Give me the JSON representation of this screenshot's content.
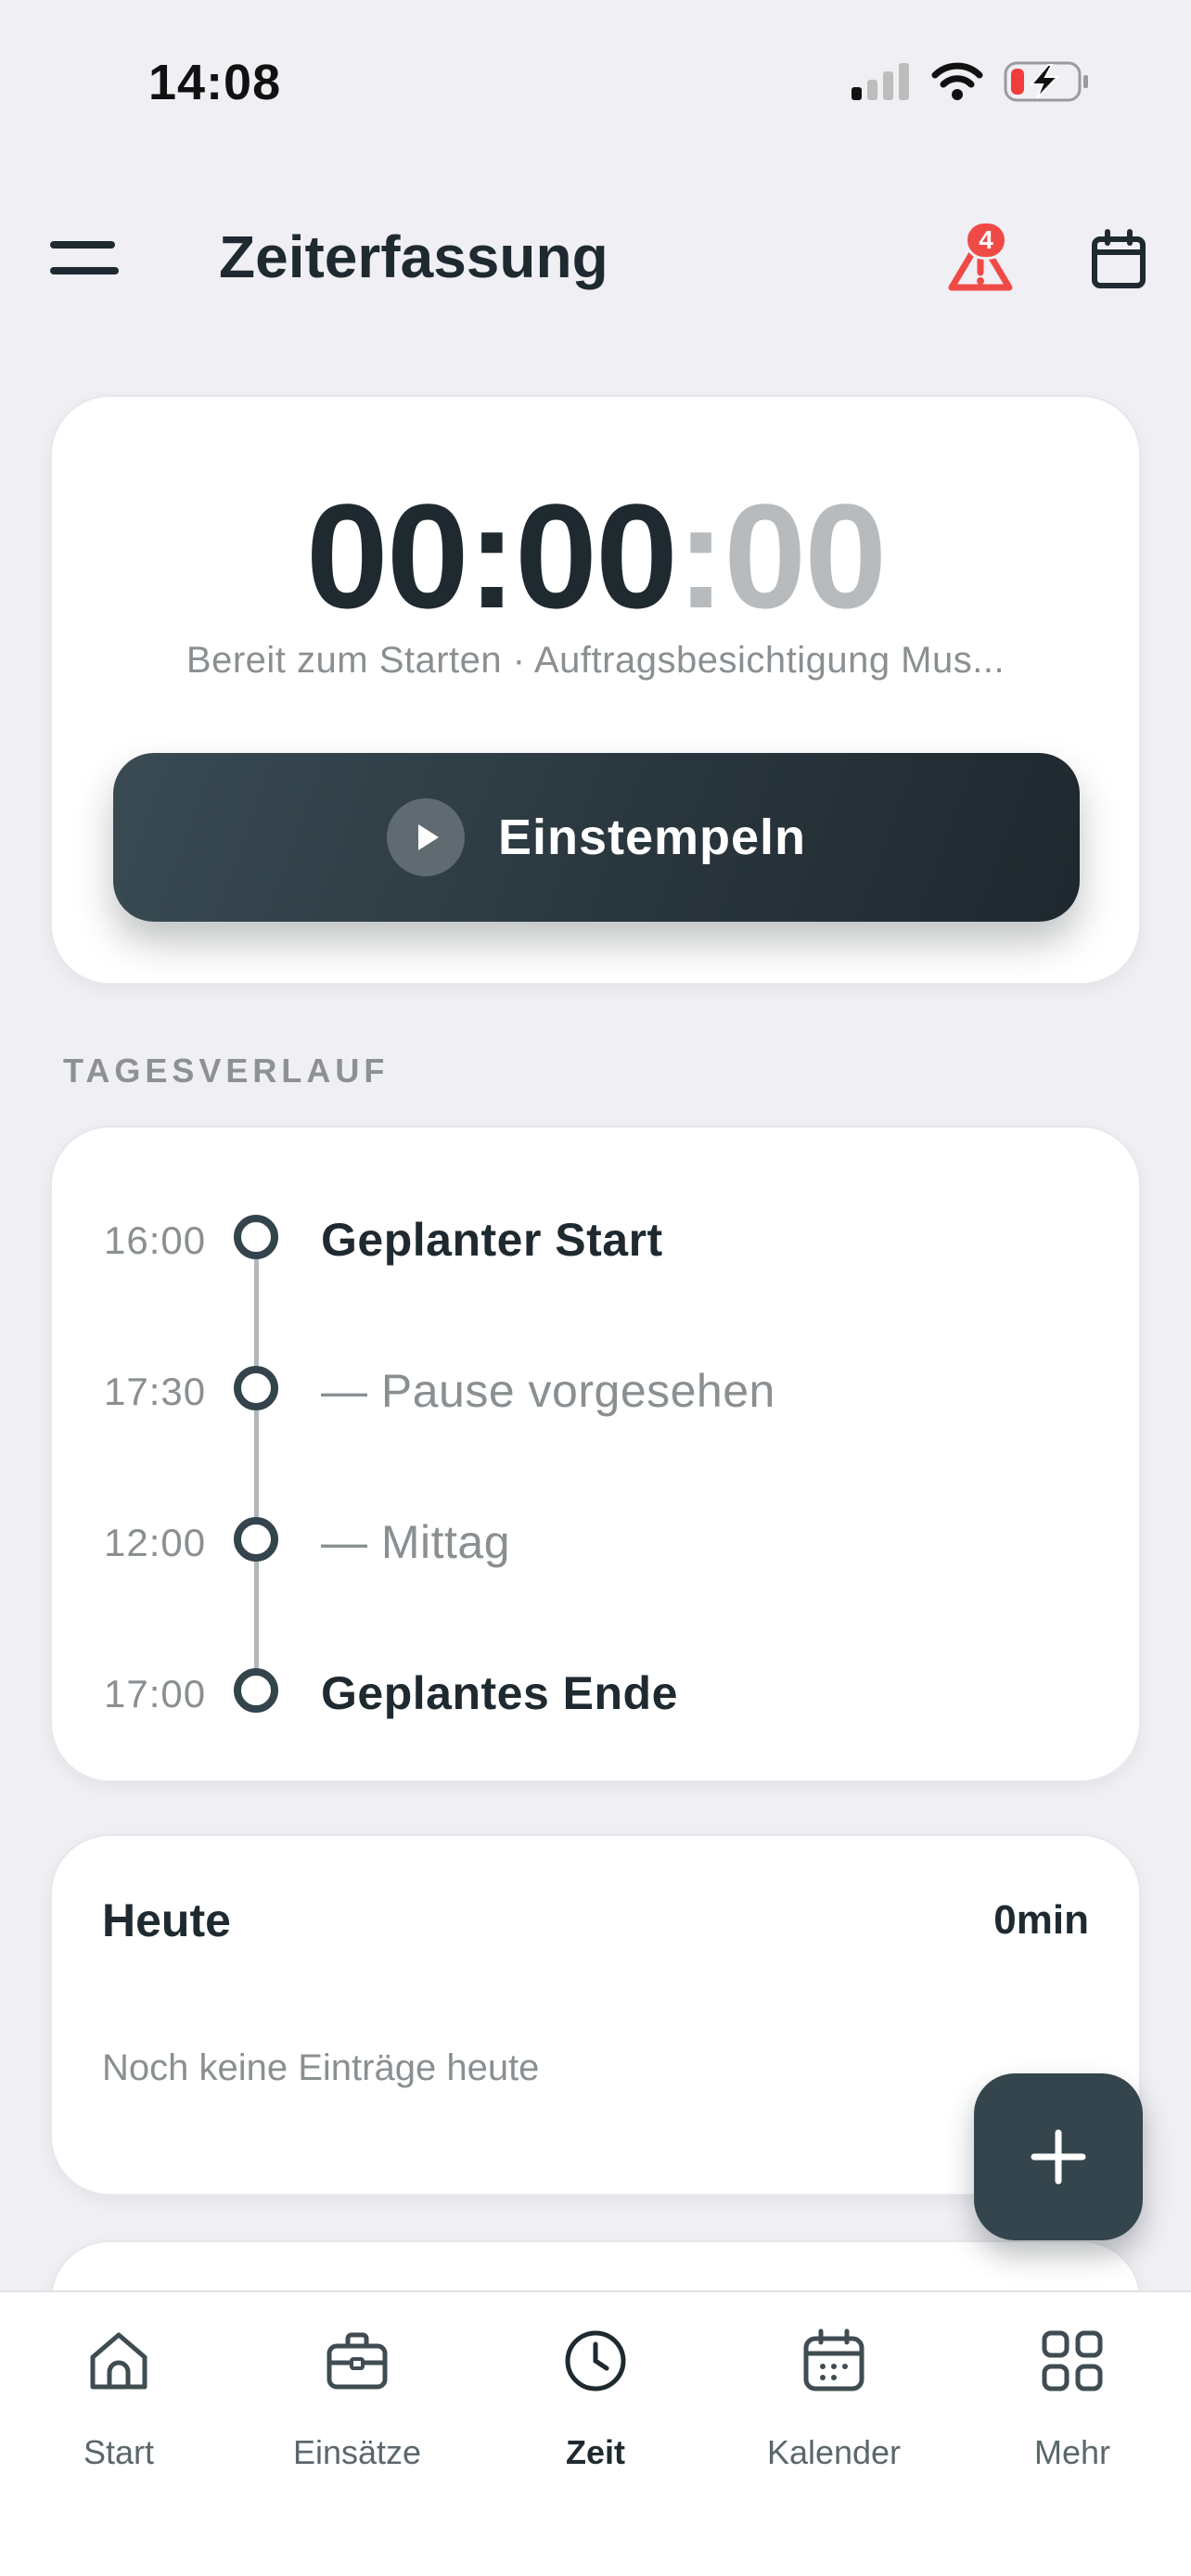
{
  "status_bar": {
    "time": "14:08"
  },
  "header": {
    "title": "Zeiterfassung",
    "alert_count": "4"
  },
  "timer": {
    "hours_minutes": "00:00",
    "separator": ":",
    "seconds": "00",
    "status": "Bereit zum Starten · Auftragsbesichtigung Mus...",
    "button_label": "Einstempeln"
  },
  "timeline": {
    "section_title": "TAGESVERLAUF",
    "items": [
      {
        "time": "16:00",
        "label": "Geplanter Start"
      },
      {
        "time": "17:30",
        "label": "— Pause vorgesehen"
      },
      {
        "time": "12:00",
        "label": "— Mittag"
      },
      {
        "time": "17:00",
        "label": "Geplantes Ende"
      }
    ]
  },
  "today": {
    "title": "Heute",
    "total": "0min",
    "empty_text": "Noch keine Einträge heute"
  },
  "tabbar": {
    "items": [
      {
        "label": "Start",
        "icon": "home-icon"
      },
      {
        "label": "Einsätze",
        "icon": "briefcase-icon"
      },
      {
        "label": "Zeit",
        "icon": "clock-icon"
      },
      {
        "label": "Kalender",
        "icon": "calendar-icon"
      },
      {
        "label": "Mehr",
        "icon": "grid-icon"
      }
    ],
    "active": "Zeit"
  },
  "colors": {
    "accent": "#34454d",
    "alert": "#f04a46",
    "background": "#efeff4"
  }
}
